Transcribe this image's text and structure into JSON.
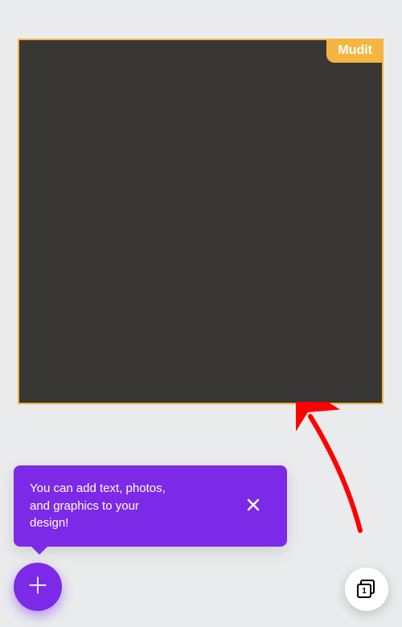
{
  "canvas": {
    "user_badge": "Mudit",
    "border_color": "#f4b63f",
    "fill_color": "#393636"
  },
  "tooltip": {
    "text": "You can add text, photos, and graphics to your design!",
    "bg_color": "#7d2ae8"
  },
  "fab": {
    "bg_color": "#7d2ae8"
  },
  "pages": {
    "count": "1"
  },
  "annotation": {
    "arrow_color": "#ff0000"
  }
}
